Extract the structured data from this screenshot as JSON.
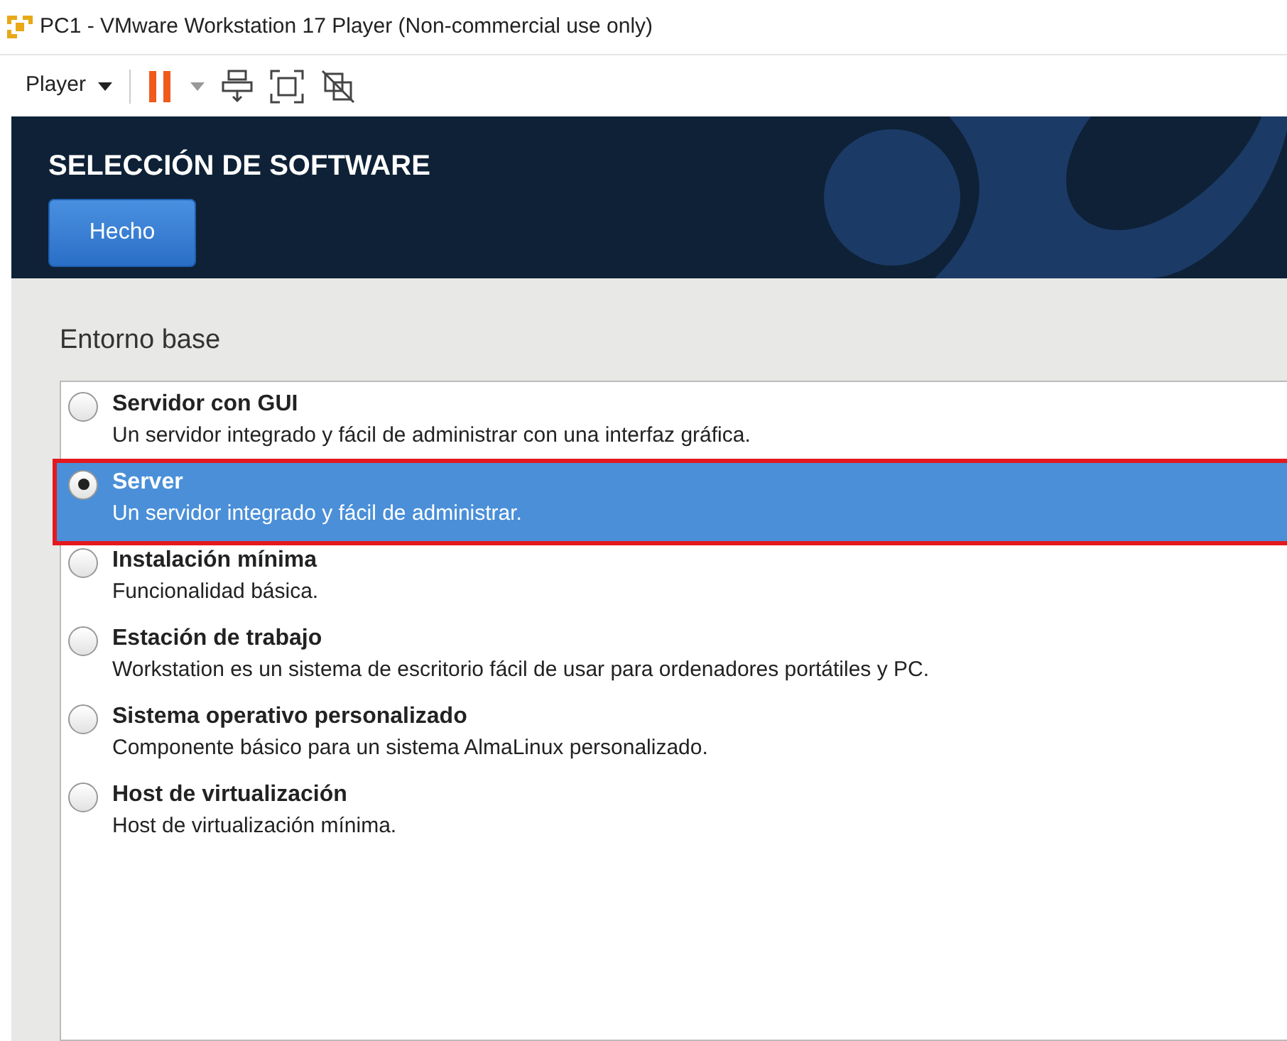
{
  "window": {
    "title": "PC1 - VMware Workstation 17 Player (Non-commercial use only)"
  },
  "toolbar": {
    "menu": "Player"
  },
  "header": {
    "title": "SELECCIÓN DE SOFTWARE",
    "done_button": "Hecho"
  },
  "section": {
    "title": "Entorno base"
  },
  "environments": [
    {
      "name": "Servidor con GUI",
      "description": "Un servidor integrado y fácil de administrar con una interfaz gráfica.",
      "selected": false
    },
    {
      "name": "Server",
      "description": "Un servidor integrado y fácil de administrar.",
      "selected": true
    },
    {
      "name": "Instalación mínima",
      "description": "Funcionalidad básica.",
      "selected": false
    },
    {
      "name": "Estación de trabajo",
      "description": "Workstation es un sistema de escritorio fácil de usar para ordenadores portátiles y PC.",
      "selected": false
    },
    {
      "name": "Sistema operativo personalizado",
      "description": "Componente básico para un sistema AlmaLinux personalizado.",
      "selected": false
    },
    {
      "name": "Host de virtualización",
      "description": "Host de virtualización mínima.",
      "selected": false
    }
  ]
}
